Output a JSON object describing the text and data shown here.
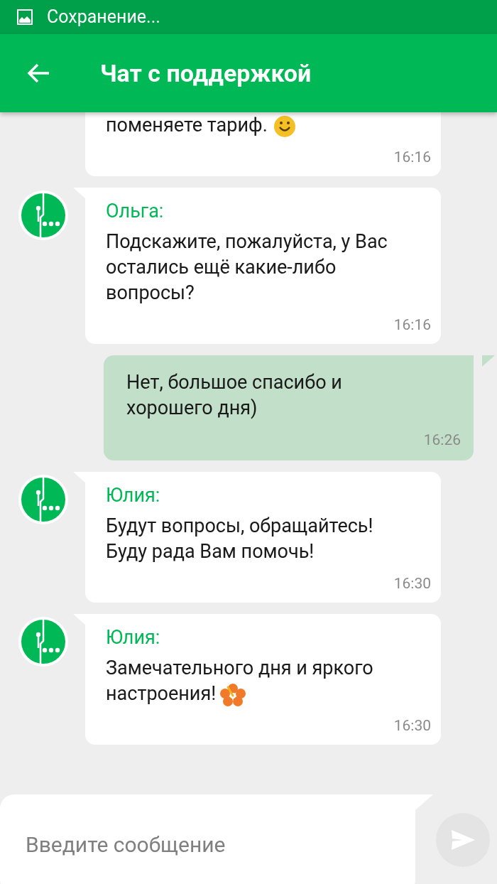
{
  "status_bar": {
    "text": "Сохранение..."
  },
  "header": {
    "title": "Чат с поддержкой"
  },
  "messages": [
    {
      "kind": "incoming",
      "avatar": false,
      "text": "поменяете тариф.",
      "emoji": {
        "kind": "smile"
      },
      "time": "16:16"
    },
    {
      "kind": "incoming",
      "avatar": true,
      "author": "Ольга:",
      "text": "Подскажите, пожалуйста, у Вас остались ещё какие-либо вопросы?",
      "time": "16:16"
    },
    {
      "kind": "outgoing",
      "text": "Нет, большое спасибо и хорошего дня)",
      "time": "16:26"
    },
    {
      "kind": "incoming",
      "avatar": true,
      "author": "Юлия:",
      "text": "Будут вопросы, обращайтесь! Буду рада Вам помочь!",
      "time": "16:30"
    },
    {
      "kind": "incoming",
      "avatar": true,
      "author": "Юлия:",
      "text": "Замечательного дня и яркого настроения!",
      "emoji": {
        "kind": "flower"
      },
      "time": "16:30"
    }
  ],
  "composer": {
    "placeholder": "Введите сообщение"
  }
}
